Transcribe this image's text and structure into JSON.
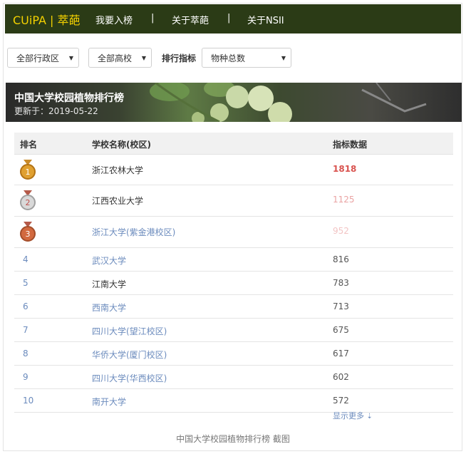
{
  "nav": {
    "brand": "CUiPA | 萃葩",
    "items": [
      "我要入榜",
      "关于萃葩",
      "关于NSII"
    ],
    "separator": "|"
  },
  "filters": {
    "region": "全部行政区",
    "school_type": "全部高校",
    "metric_label": "排行指标",
    "metric": "物种总数"
  },
  "banner": {
    "title": "中国大学校园植物排行榜",
    "updated": "更新于：2019-05-22"
  },
  "table": {
    "headers": [
      "排名",
      "学校名称(校区)",
      "指标数据"
    ],
    "rows": [
      {
        "rank": "1",
        "school": "浙江农林大学",
        "value": "1818"
      },
      {
        "rank": "2",
        "school": "江西农业大学",
        "value": "1125"
      },
      {
        "rank": "3",
        "school": "浙江大学(紫金港校区)",
        "value": "952"
      },
      {
        "rank": "4",
        "school": "武汉大学",
        "value": "816"
      },
      {
        "rank": "5",
        "school": "江南大学",
        "value": "783"
      },
      {
        "rank": "6",
        "school": "西南大学",
        "value": "713"
      },
      {
        "rank": "7",
        "school": "四川大学(望江校区)",
        "value": "675"
      },
      {
        "rank": "8",
        "school": "华侨大学(厦门校区)",
        "value": "617"
      },
      {
        "rank": "9",
        "school": "四川大学(华西校区)",
        "value": "602"
      },
      {
        "rank": "10",
        "school": "南开大学",
        "value": "572"
      }
    ],
    "show_more": "显示更多",
    "colors": {
      "gold_value": "#d9534f",
      "silver_value": "#eaa3a3",
      "bronze_value": "#f2c4c4",
      "link": "#6b8bbd"
    }
  },
  "caption": "中国大学校园植物排行榜  截图"
}
